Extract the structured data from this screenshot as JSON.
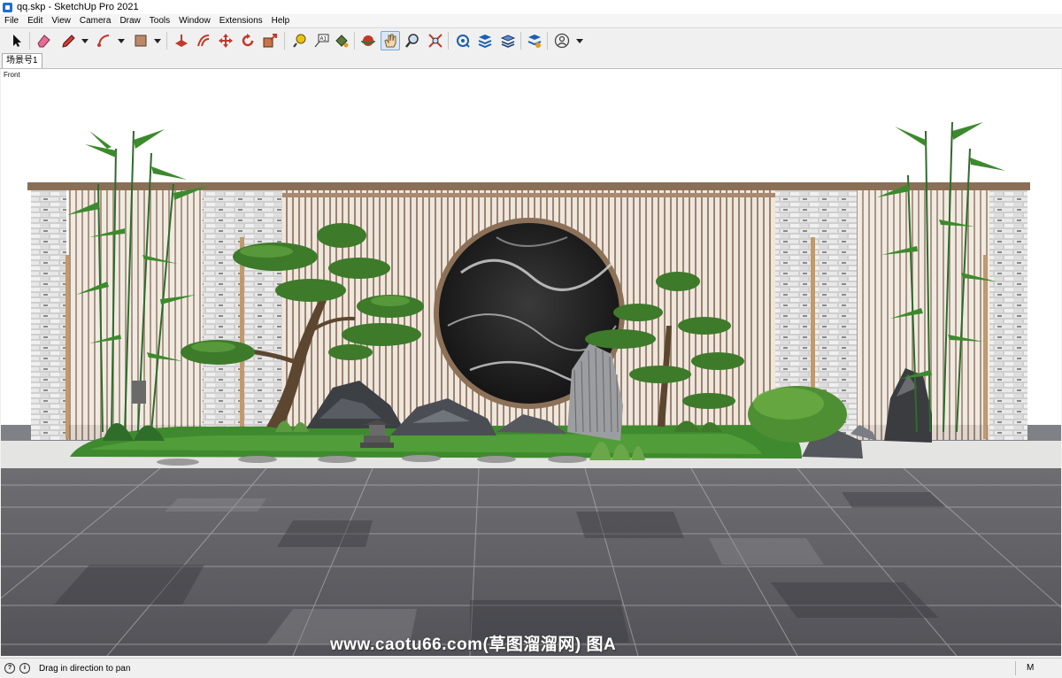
{
  "window": {
    "title": "qq.skp - SketchUp Pro 2021"
  },
  "menu": [
    "File",
    "Edit",
    "View",
    "Camera",
    "Draw",
    "Tools",
    "Window",
    "Extensions",
    "Help"
  ],
  "toolbar": {
    "tools": [
      {
        "name": "select-tool-button",
        "icon": "arrow-cursor-icon"
      },
      {
        "name": "eraser-tool-button",
        "icon": "eraser-icon"
      },
      {
        "name": "line-tool-button",
        "icon": "pencil-icon",
        "dropdown": true
      },
      {
        "name": "arc-tool-button",
        "icon": "arc-icon",
        "dropdown": true
      },
      {
        "name": "rectangle-tool-button",
        "icon": "rectangle-icon",
        "dropdown": true
      },
      {
        "name": "push-pull-tool-button",
        "icon": "push-pull-icon"
      },
      {
        "name": "offset-tool-button",
        "icon": "offset-icon"
      },
      {
        "name": "move-tool-button",
        "icon": "move-icon"
      },
      {
        "name": "rotate-tool-button",
        "icon": "rotate-icon"
      },
      {
        "name": "scale-tool-button",
        "icon": "scale-icon"
      },
      {
        "name": "tape-measure-tool-button",
        "icon": "tape-measure-icon"
      },
      {
        "name": "text-tool-button",
        "icon": "text-icon"
      },
      {
        "name": "paint-bucket-tool-button",
        "icon": "paint-bucket-icon"
      },
      {
        "name": "orbit-tool-button",
        "icon": "orbit-icon"
      },
      {
        "name": "pan-tool-button",
        "icon": "hand-icon",
        "active": true
      },
      {
        "name": "zoom-tool-button",
        "icon": "zoom-icon"
      },
      {
        "name": "zoom-extents-tool-button",
        "icon": "zoom-extents-icon"
      },
      {
        "name": "3d-warehouse-button",
        "icon": "warehouse-icon"
      },
      {
        "name": "extension-warehouse-button",
        "icon": "extension-icon"
      },
      {
        "name": "layout-button",
        "icon": "layout-icon"
      },
      {
        "name": "extension-manager-button",
        "icon": "extension-manager-icon"
      },
      {
        "name": "account-button",
        "icon": "account-icon",
        "dropdown": true
      }
    ]
  },
  "scene_tabs": [
    "场景号1"
  ],
  "viewport": {
    "view_name": "Front"
  },
  "watermark": "www.caotu66.com(草图溜溜网) 图A",
  "status": {
    "message": "Drag in direction to pan",
    "measurements_label": "M"
  }
}
